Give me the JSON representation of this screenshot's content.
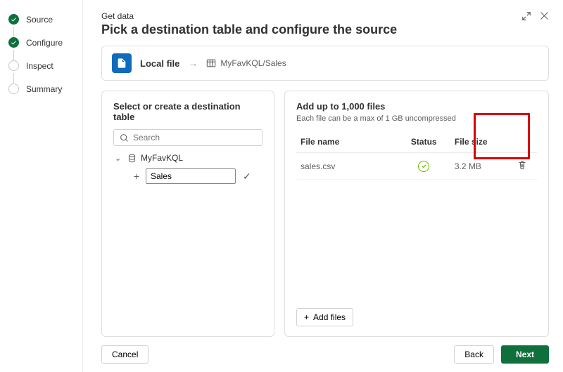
{
  "steps": {
    "source": "Source",
    "configure": "Configure",
    "inspect": "Inspect",
    "summary": "Summary"
  },
  "header": {
    "small": "Get data",
    "title": "Pick a destination table and configure the source"
  },
  "crumb": {
    "source_label": "Local file",
    "path": "MyFavKQL/Sales"
  },
  "left_panel": {
    "title": "Select or create a destination table",
    "search_placeholder": "Search",
    "db_name": "MyFavKQL",
    "table_value": "Sales"
  },
  "right_panel": {
    "title": "Add up to 1,000 files",
    "subtitle": "Each file can be a max of 1 GB uncompressed",
    "col_file": "File name",
    "col_status": "Status",
    "col_size": "File size",
    "row1_name": "sales.csv",
    "row1_size": "3.2 MB",
    "add_files_label": "Add files"
  },
  "footer": {
    "cancel": "Cancel",
    "back": "Back",
    "next": "Next"
  }
}
